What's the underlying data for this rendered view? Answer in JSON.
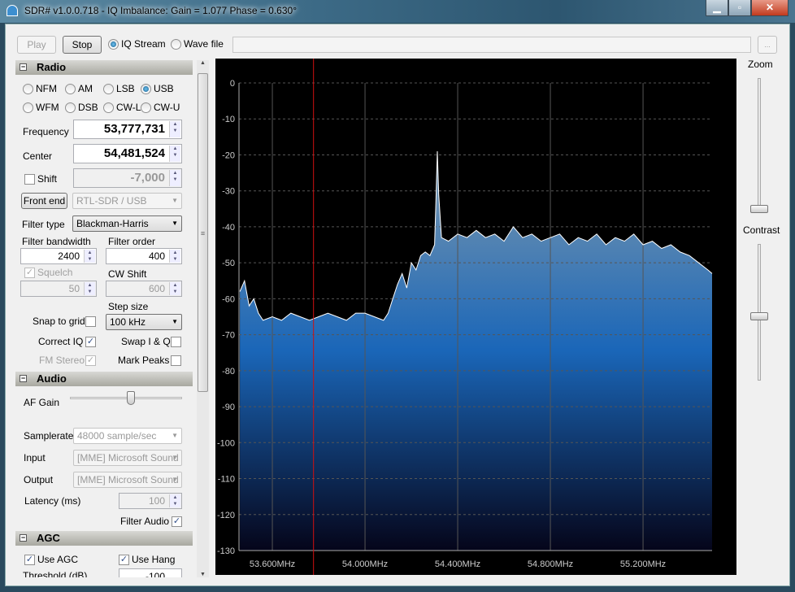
{
  "window": {
    "title": "SDR# v1.0.0.718 - IQ Imbalance: Gain = 1.077 Phase = 0.630°",
    "minimize": "▁",
    "maximize": "▫",
    "close": "✕"
  },
  "toolbar": {
    "play": "Play",
    "stop": "Stop",
    "iq_stream": "IQ Stream",
    "wave_file": "Wave file",
    "source_selected": "IQ Stream",
    "file_path": "",
    "browse": "..."
  },
  "radio": {
    "title": "Radio",
    "modes": [
      "NFM",
      "AM",
      "LSB",
      "USB",
      "WFM",
      "DSB",
      "CW-L",
      "CW-U"
    ],
    "selected_mode": "USB",
    "frequency_label": "Frequency",
    "frequency": "53,777,731",
    "center_label": "Center",
    "center": "54,481,524",
    "shift_label": "Shift",
    "shift_checked": false,
    "shift": "-7,000",
    "front_end_label": "Front end",
    "front_end": "RTL-SDR / USB",
    "filter_type_label": "Filter type",
    "filter_type": "Blackman-Harris",
    "filter_bandwidth_label": "Filter bandwidth",
    "filter_bandwidth": "2400",
    "filter_order_label": "Filter order",
    "filter_order": "400",
    "squelch_label": "Squelch",
    "squelch_checked": true,
    "squelch": "50",
    "cw_shift_label": "CW Shift",
    "cw_shift": "600",
    "step_size_label": "Step size",
    "step_size": "100 kHz",
    "snap_label": "Snap to grid",
    "snap_checked": false,
    "correct_iq_label": "Correct IQ",
    "correct_iq_checked": true,
    "swap_label": "Swap I & Q",
    "swap_checked": false,
    "fm_stereo_label": "FM Stereo",
    "fm_stereo_checked": true,
    "mark_peaks_label": "Mark Peaks",
    "mark_peaks_checked": false
  },
  "audio": {
    "title": "Audio",
    "af_gain_label": "AF Gain",
    "af_gain_fraction": 0.55,
    "samplerate_label": "Samplerate",
    "samplerate": "48000 sample/sec",
    "input_label": "Input",
    "input": "[MME] Microsoft Sound",
    "output_label": "Output",
    "output": "[MME] Microsoft Sound",
    "latency_label": "Latency (ms)",
    "latency": "100",
    "filter_audio_label": "Filter Audio",
    "filter_audio_checked": true
  },
  "agc": {
    "title": "AGC",
    "use_agc_label": "Use AGC",
    "use_agc_checked": true,
    "use_hang_label": "Use Hang",
    "use_hang_checked": true,
    "threshold_label": "Threshold (dB)",
    "threshold": "-100"
  },
  "right": {
    "zoom_label": "Zoom",
    "zoom_fraction": 0.0,
    "contrast_label": "Contrast",
    "contrast_fraction": 0.5
  },
  "colors": {
    "marker": "#d01010",
    "fill_top": "#6a8fb0",
    "fill_mid": "#1a66b8",
    "fill_bottom": "#05051a",
    "trace": "#ffffff"
  },
  "chart_data": {
    "type": "area",
    "xlabel": "",
    "ylabel": "",
    "ylim": [
      -130,
      0
    ],
    "xlim_mhz": [
      53.456,
      55.498
    ],
    "yticks": [
      "0",
      "-10",
      "-20",
      "-30",
      "-40",
      "-50",
      "-60",
      "-70",
      "-80",
      "-90",
      "-100",
      "-110",
      "-120",
      "-130"
    ],
    "xticks": [
      {
        "mhz": 53.6,
        "label": "53.600MHz"
      },
      {
        "mhz": 54.0,
        "label": "54.000MHz"
      },
      {
        "mhz": 54.4,
        "label": "54.400MHz"
      },
      {
        "mhz": 54.8,
        "label": "54.800MHz"
      },
      {
        "mhz": 55.2,
        "label": "55.200MHz"
      }
    ],
    "grid": true,
    "marker_mhz": 53.7777,
    "x": [
      53.46,
      53.48,
      53.5,
      53.52,
      53.54,
      53.56,
      53.6,
      53.64,
      53.68,
      53.72,
      53.76,
      53.8,
      53.84,
      53.88,
      53.92,
      53.96,
      54.0,
      54.04,
      54.08,
      54.1,
      54.12,
      54.14,
      54.16,
      54.18,
      54.2,
      54.22,
      54.24,
      54.26,
      54.28,
      54.3,
      54.305,
      54.312,
      54.318,
      54.33,
      54.36,
      54.4,
      54.44,
      54.48,
      54.52,
      54.56,
      54.6,
      54.64,
      54.68,
      54.72,
      54.76,
      54.8,
      54.84,
      54.88,
      54.92,
      54.96,
      55.0,
      55.04,
      55.08,
      55.12,
      55.16,
      55.2,
      55.24,
      55.28,
      55.32,
      55.36,
      55.4,
      55.44,
      55.48,
      55.498
    ],
    "y": [
      -58,
      -55,
      -62,
      -60,
      -64,
      -66,
      -65,
      -66,
      -64,
      -65,
      -66,
      -65,
      -64,
      -65,
      -66,
      -64,
      -64,
      -65,
      -66,
      -64,
      -60,
      -56,
      -53,
      -57,
      -50,
      -52,
      -48,
      -47,
      -48,
      -45,
      -35,
      -19,
      -31,
      -43,
      -44,
      -42,
      -43,
      -41,
      -43,
      -42,
      -44,
      -40,
      -43,
      -42,
      -44,
      -43,
      -42,
      -45,
      -43,
      -44,
      -42,
      -45,
      -43,
      -44,
      -42,
      -45,
      -44,
      -46,
      -45,
      -47,
      -48,
      -50,
      -52,
      -53
    ]
  }
}
